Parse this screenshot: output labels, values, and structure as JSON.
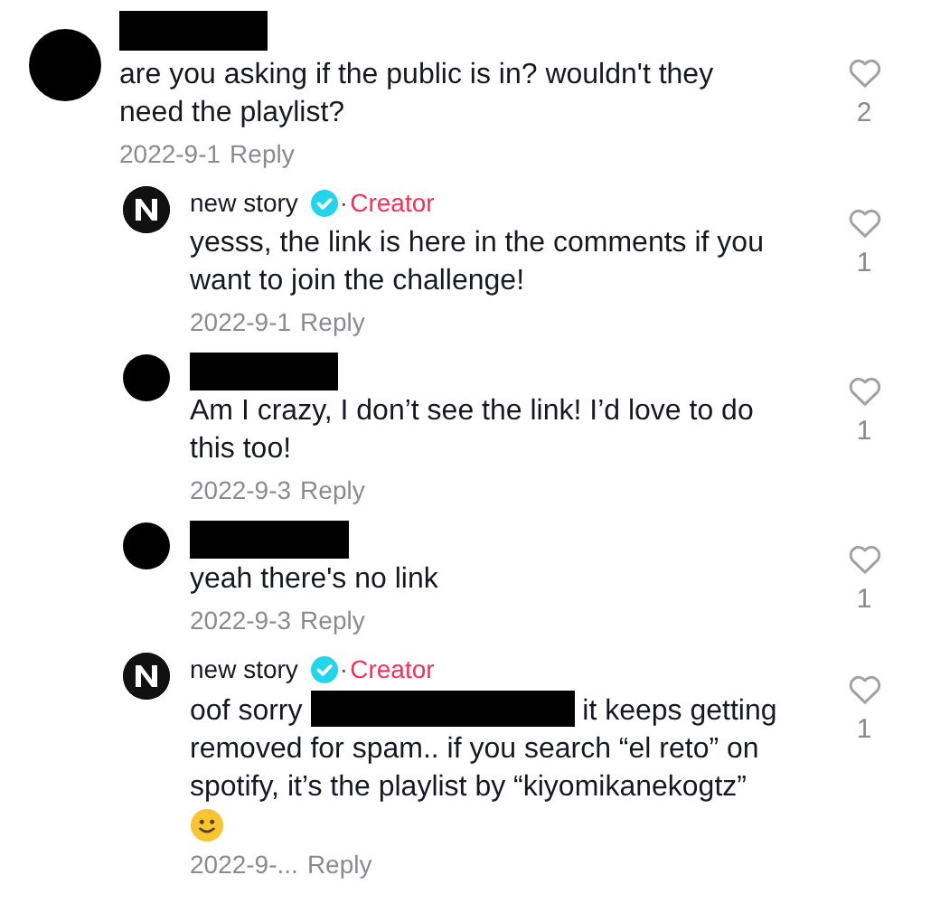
{
  "comments": [
    {
      "kind": "comment",
      "avatar": {
        "kind": "plain"
      },
      "author": {
        "redacted": true
      },
      "text": [
        {
          "kind": "text",
          "text": "are you asking if the public is in? wouldn't they need the playlist?"
        }
      ],
      "date": "2022-9-1",
      "reply": "Reply",
      "likes": "2",
      "liked": false
    },
    {
      "kind": "reply",
      "avatar": {
        "kind": "logo"
      },
      "author": {
        "redacted": false,
        "name": "new story",
        "verified": true,
        "separator": "·",
        "badge": "Creator"
      },
      "text": [
        {
          "kind": "text",
          "text": "yesss, the link is here in the comments if you want to join the challenge!"
        }
      ],
      "date": "2022-9-1",
      "reply": "Reply",
      "likes": "1",
      "liked": false
    },
    {
      "kind": "reply",
      "avatar": {
        "kind": "plain"
      },
      "author": {
        "redacted": true
      },
      "text": [
        {
          "kind": "text",
          "text": "Am I crazy, I don’t see the link! I’d love to do this too!"
        }
      ],
      "date": "2022-9-3",
      "reply": "Reply",
      "likes": "1",
      "liked": false
    },
    {
      "kind": "reply",
      "avatar": {
        "kind": "plain"
      },
      "author": {
        "redacted": true
      },
      "text": [
        {
          "kind": "text",
          "text": "yeah there's no link"
        }
      ],
      "date": "2022-9-3",
      "reply": "Reply",
      "likes": "1",
      "liked": false
    },
    {
      "kind": "reply",
      "avatar": {
        "kind": "logo"
      },
      "author": {
        "redacted": false,
        "name": "new story",
        "verified": true,
        "separator": "·",
        "badge": "Creator"
      },
      "text": [
        {
          "kind": "text",
          "text": "oof sorry"
        },
        {
          "kind": "redacted"
        },
        {
          "kind": "text",
          "text": "it keeps getting removed for spam.. if you search “el reto” on spotify, it’s the playlist by “kiyomikanekogtz”"
        },
        {
          "kind": "emoji"
        }
      ],
      "date": "2022-9-...",
      "reply": "Reply",
      "likes": "1",
      "liked": false
    }
  ]
}
